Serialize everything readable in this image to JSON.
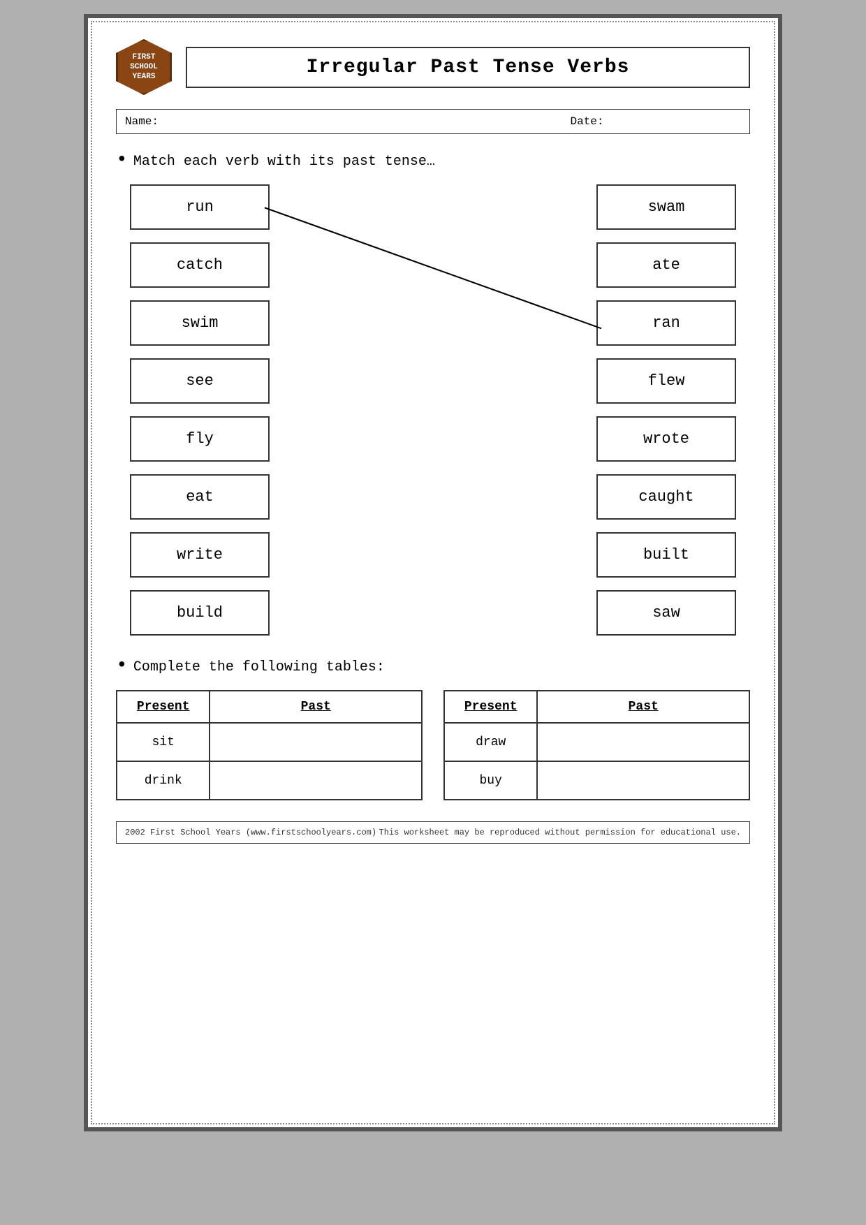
{
  "header": {
    "logo": {
      "line1": "FIRST",
      "line2": "SCHOOL",
      "line3": "YEARS"
    },
    "title": "Irregular Past Tense Verbs"
  },
  "nameDate": {
    "nameLabel": "Name:",
    "dateLabel": "Date:"
  },
  "instruction1": "Match each verb with its past tense…",
  "leftVerbs": [
    {
      "id": "run",
      "label": "run"
    },
    {
      "id": "catch",
      "label": "catch"
    },
    {
      "id": "swim",
      "label": "swim"
    },
    {
      "id": "see",
      "label": "see"
    },
    {
      "id": "fly",
      "label": "fly"
    },
    {
      "id": "eat",
      "label": "eat"
    },
    {
      "id": "write",
      "label": "write"
    },
    {
      "id": "build",
      "label": "build"
    }
  ],
  "rightVerbs": [
    {
      "id": "swam",
      "label": "swam"
    },
    {
      "id": "ate",
      "label": "ate"
    },
    {
      "id": "ran",
      "label": "ran"
    },
    {
      "id": "flew",
      "label": "flew"
    },
    {
      "id": "wrote",
      "label": "wrote"
    },
    {
      "id": "caught",
      "label": "caught"
    },
    {
      "id": "built",
      "label": "built"
    },
    {
      "id": "saw",
      "label": "saw"
    }
  ],
  "instruction2": "Complete the following tables:",
  "table1": {
    "headers": [
      "Present",
      "Past"
    ],
    "rows": [
      {
        "present": "sit",
        "past": ""
      },
      {
        "present": "drink",
        "past": ""
      }
    ]
  },
  "table2": {
    "headers": [
      "Present",
      "Past"
    ],
    "rows": [
      {
        "present": "draw",
        "past": ""
      },
      {
        "present": "buy",
        "past": ""
      }
    ]
  },
  "footer": {
    "left": "2002 First School Years  (www.firstschoolyears.com)",
    "right": "This worksheet may be reproduced without permission for educational use."
  }
}
